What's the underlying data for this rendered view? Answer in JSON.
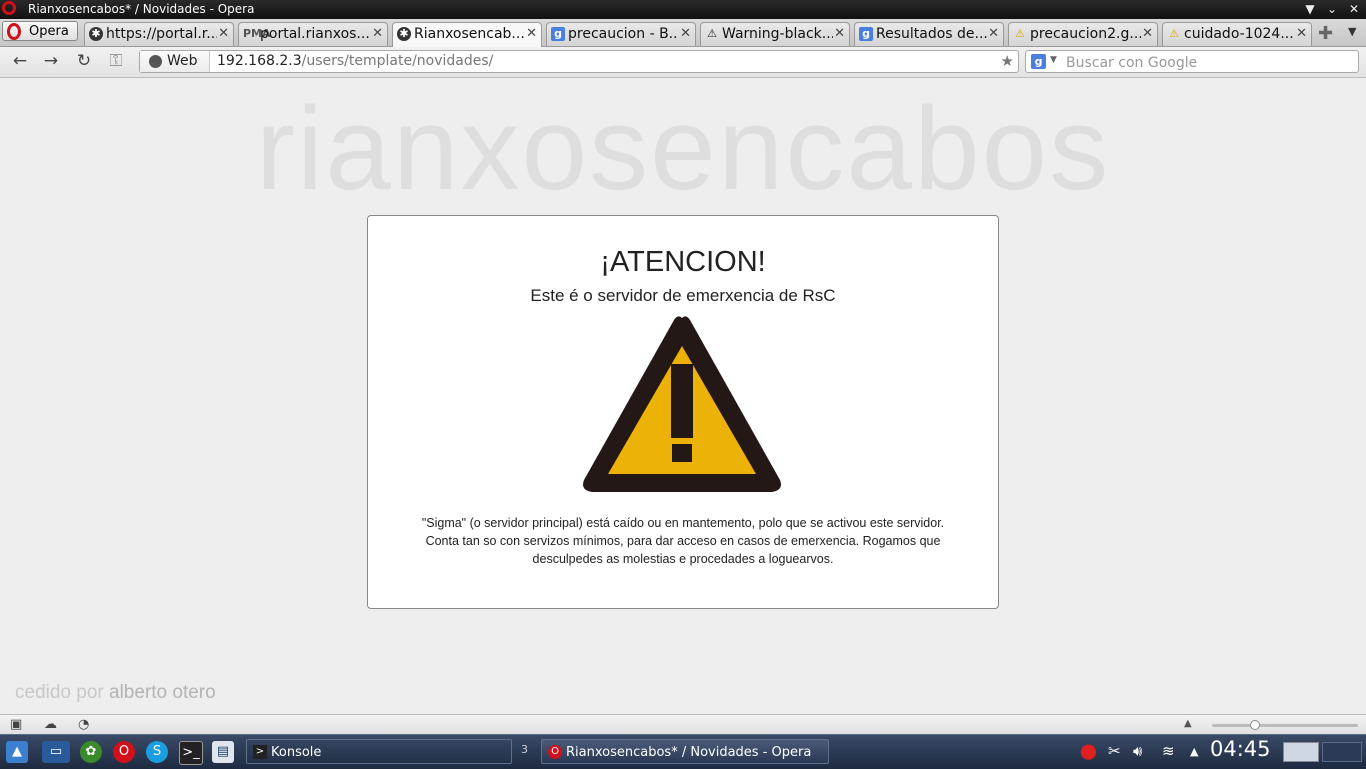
{
  "window": {
    "title": "Rianxosencabos* / Novidades - Opera",
    "controls": [
      "▼",
      "⌄",
      "✕"
    ]
  },
  "opera_menu": {
    "label": "Opera"
  },
  "tabs": [
    {
      "label": "https://portal.r...",
      "icon": "circle-o-icon",
      "close": "✕"
    },
    {
      "label": "portal.rianxos...",
      "icon": "pma-icon",
      "close": "✕"
    },
    {
      "label": "Rianxosencab...",
      "icon": "circle-o-icon",
      "active": true,
      "close": "✕"
    },
    {
      "label": "precaucion - B...",
      "icon": "google-icon",
      "close": "✕"
    },
    {
      "label": "Warning-black...",
      "icon": "warning-icon",
      "close": "✕"
    },
    {
      "label": "Resultados de...",
      "icon": "google-icon",
      "close": "✕"
    },
    {
      "label": "precaucion2.g...",
      "icon": "warning-yellow-icon",
      "close": "✕"
    },
    {
      "label": "cuidado-1024...",
      "icon": "warning-black-icon",
      "close": "✕"
    }
  ],
  "navbar": {
    "web_label": "Web",
    "url_host": "192.168.2.3",
    "url_path": "/users/template/novidades/",
    "search_placeholder": "Buscar con Google",
    "search_engine_letter": "g"
  },
  "page": {
    "watermark": "rianxosencabos",
    "heading": "¡ATENCION!",
    "subheading": "Este é o servidor de emerxencia de RsC",
    "body_text": "\"Sigma\" (o servidor principal) está caído ou en mantemento, polo que se activou este servidor. Conta tan so con servizos mínimos, para dar acceso en casos de emerxencia. Rogamos que desculpedes as molestias e procedades a loguearvos.",
    "credit_prefix": "cedido por",
    "credit_author": "alberto otero",
    "sign_colors": {
      "fill": "#edb208",
      "stroke": "#231815"
    }
  },
  "statusbar": {
    "zoom_level": 0.28
  },
  "taskbar": {
    "tasks": [
      {
        "label": "Konsole",
        "icon": "terminal-icon"
      },
      {
        "label": "Rianxosencabos* / Novidades - Opera",
        "icon": "opera-icon",
        "active": true
      }
    ],
    "pager": "3",
    "clock": "04:45"
  }
}
